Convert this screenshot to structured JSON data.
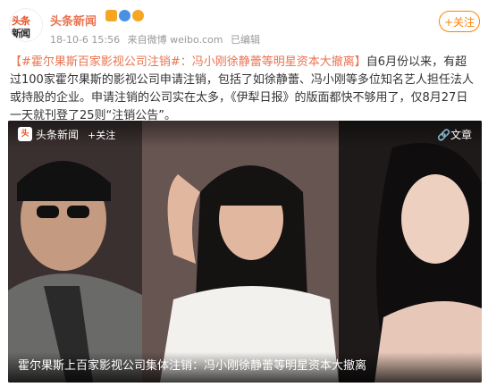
{
  "header": {
    "avatar_line1": "头条",
    "avatar_line2": "新闻",
    "username": "头条新闻",
    "badge_colors": [
      "#f5a623",
      "#4a90e2",
      "#f5a623"
    ],
    "timestamp": "18-10-6 15:56",
    "source": "来自微博 weibo.com",
    "edited": "已编辑",
    "follow_label": "+关注"
  },
  "post": {
    "hashtag": "【#霍尔果斯百家影视公司注销#：冯小刚徐静蕾等明星资本大撤离】",
    "body": "自6月份以来，有超过100家霍尔果斯的影视公司申请注销，包括了如徐静蕾、冯小刚等多位知名艺人担任法人或持股的企业。申请注销的公司实在太多，《伊犁日报》的版面都快不够用了，仅8月27日一天就刊登了25则“注销公告”。"
  },
  "media": {
    "logo_text": "头",
    "source_label": "头条新闻",
    "follow_label": "+关注",
    "article_label": "文章",
    "caption": "霍尔果斯上百家影视公司集体注销：冯小刚徐静蕾等明星资本大撤离"
  }
}
